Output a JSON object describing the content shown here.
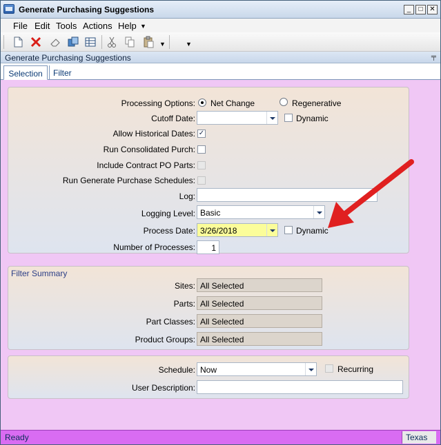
{
  "window": {
    "title": "Generate Purchasing Suggestions",
    "min_icon": "minimize-icon",
    "max_icon": "maximize-icon",
    "close_icon": "close-icon"
  },
  "menu": [
    "File",
    "Edit",
    "Tools",
    "Actions",
    "Help"
  ],
  "panel": {
    "title": "Generate Purchasing Suggestions"
  },
  "tabs": {
    "selection": "Selection",
    "filter": "Filter"
  },
  "form": {
    "processing_options_label": "Processing Options:",
    "net_change": "Net Change",
    "regenerative": "Regenerative",
    "cutoff_date_label": "Cutoff Date:",
    "cutoff_date_value": "",
    "dynamic_label": "Dynamic",
    "allow_historical_label": "Allow Historical Dates:",
    "run_consolidated_label": "Run Consolidated Purch:",
    "include_contract_label": "Include Contract PO Parts:",
    "run_generate_label": "Run Generate Purchase Schedules:",
    "log_label": "Log:",
    "log_value": "",
    "logging_level_label": "Logging Level:",
    "logging_level_value": "Basic",
    "process_date_label": "Process Date:",
    "process_date_value": "3/26/2018",
    "process_dynamic_label": "Dynamic",
    "num_processes_label": "Number of Processes:",
    "num_processes_value": "1"
  },
  "filter_summary": {
    "title": "Filter Summary",
    "sites_label": "Sites:",
    "sites_value": "All Selected",
    "parts_label": "Parts:",
    "parts_value": "All Selected",
    "part_classes_label": "Part Classes:",
    "part_classes_value": "All Selected",
    "product_groups_label": "Product Groups:",
    "product_groups_value": "All Selected"
  },
  "schedule": {
    "schedule_label": "Schedule:",
    "schedule_value": "Now",
    "recurring_label": "Recurring",
    "user_description_label": "User Description:",
    "user_description_value": ""
  },
  "status": {
    "ready": "Ready",
    "location": "Texas"
  },
  "colors": {
    "background": "#f0c7f5",
    "statusbar": "#d96cf2",
    "highlight": "#f5fa3c",
    "arrow": "#e02020"
  }
}
